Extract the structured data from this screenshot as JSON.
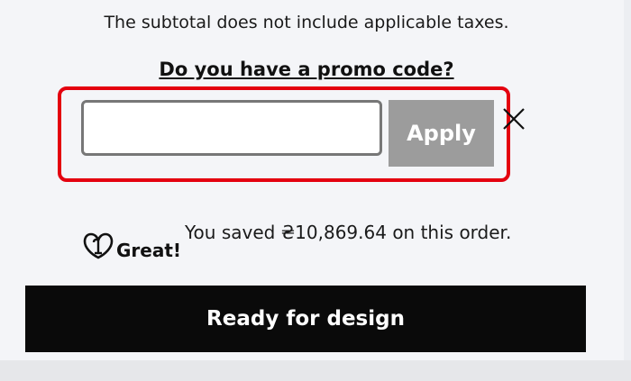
{
  "cart": {
    "subtotal_note": "The subtotal does not include applicable taxes.",
    "promo_prompt": "Do you have a promo code?",
    "promo_input_value": "",
    "apply_label": "Apply",
    "savings_badge": "Great!",
    "savings_message": "You saved ₴10,869.64 on this order.",
    "checkout_label": "Ready for design"
  },
  "icons": {
    "close": "close-icon",
    "logo": "godaddy-logo-icon"
  },
  "colors": {
    "highlight": "#e4000f",
    "apply_button": "#9c9c9c",
    "checkout_button": "#0a0a0a",
    "background": "#f4f5f8"
  }
}
